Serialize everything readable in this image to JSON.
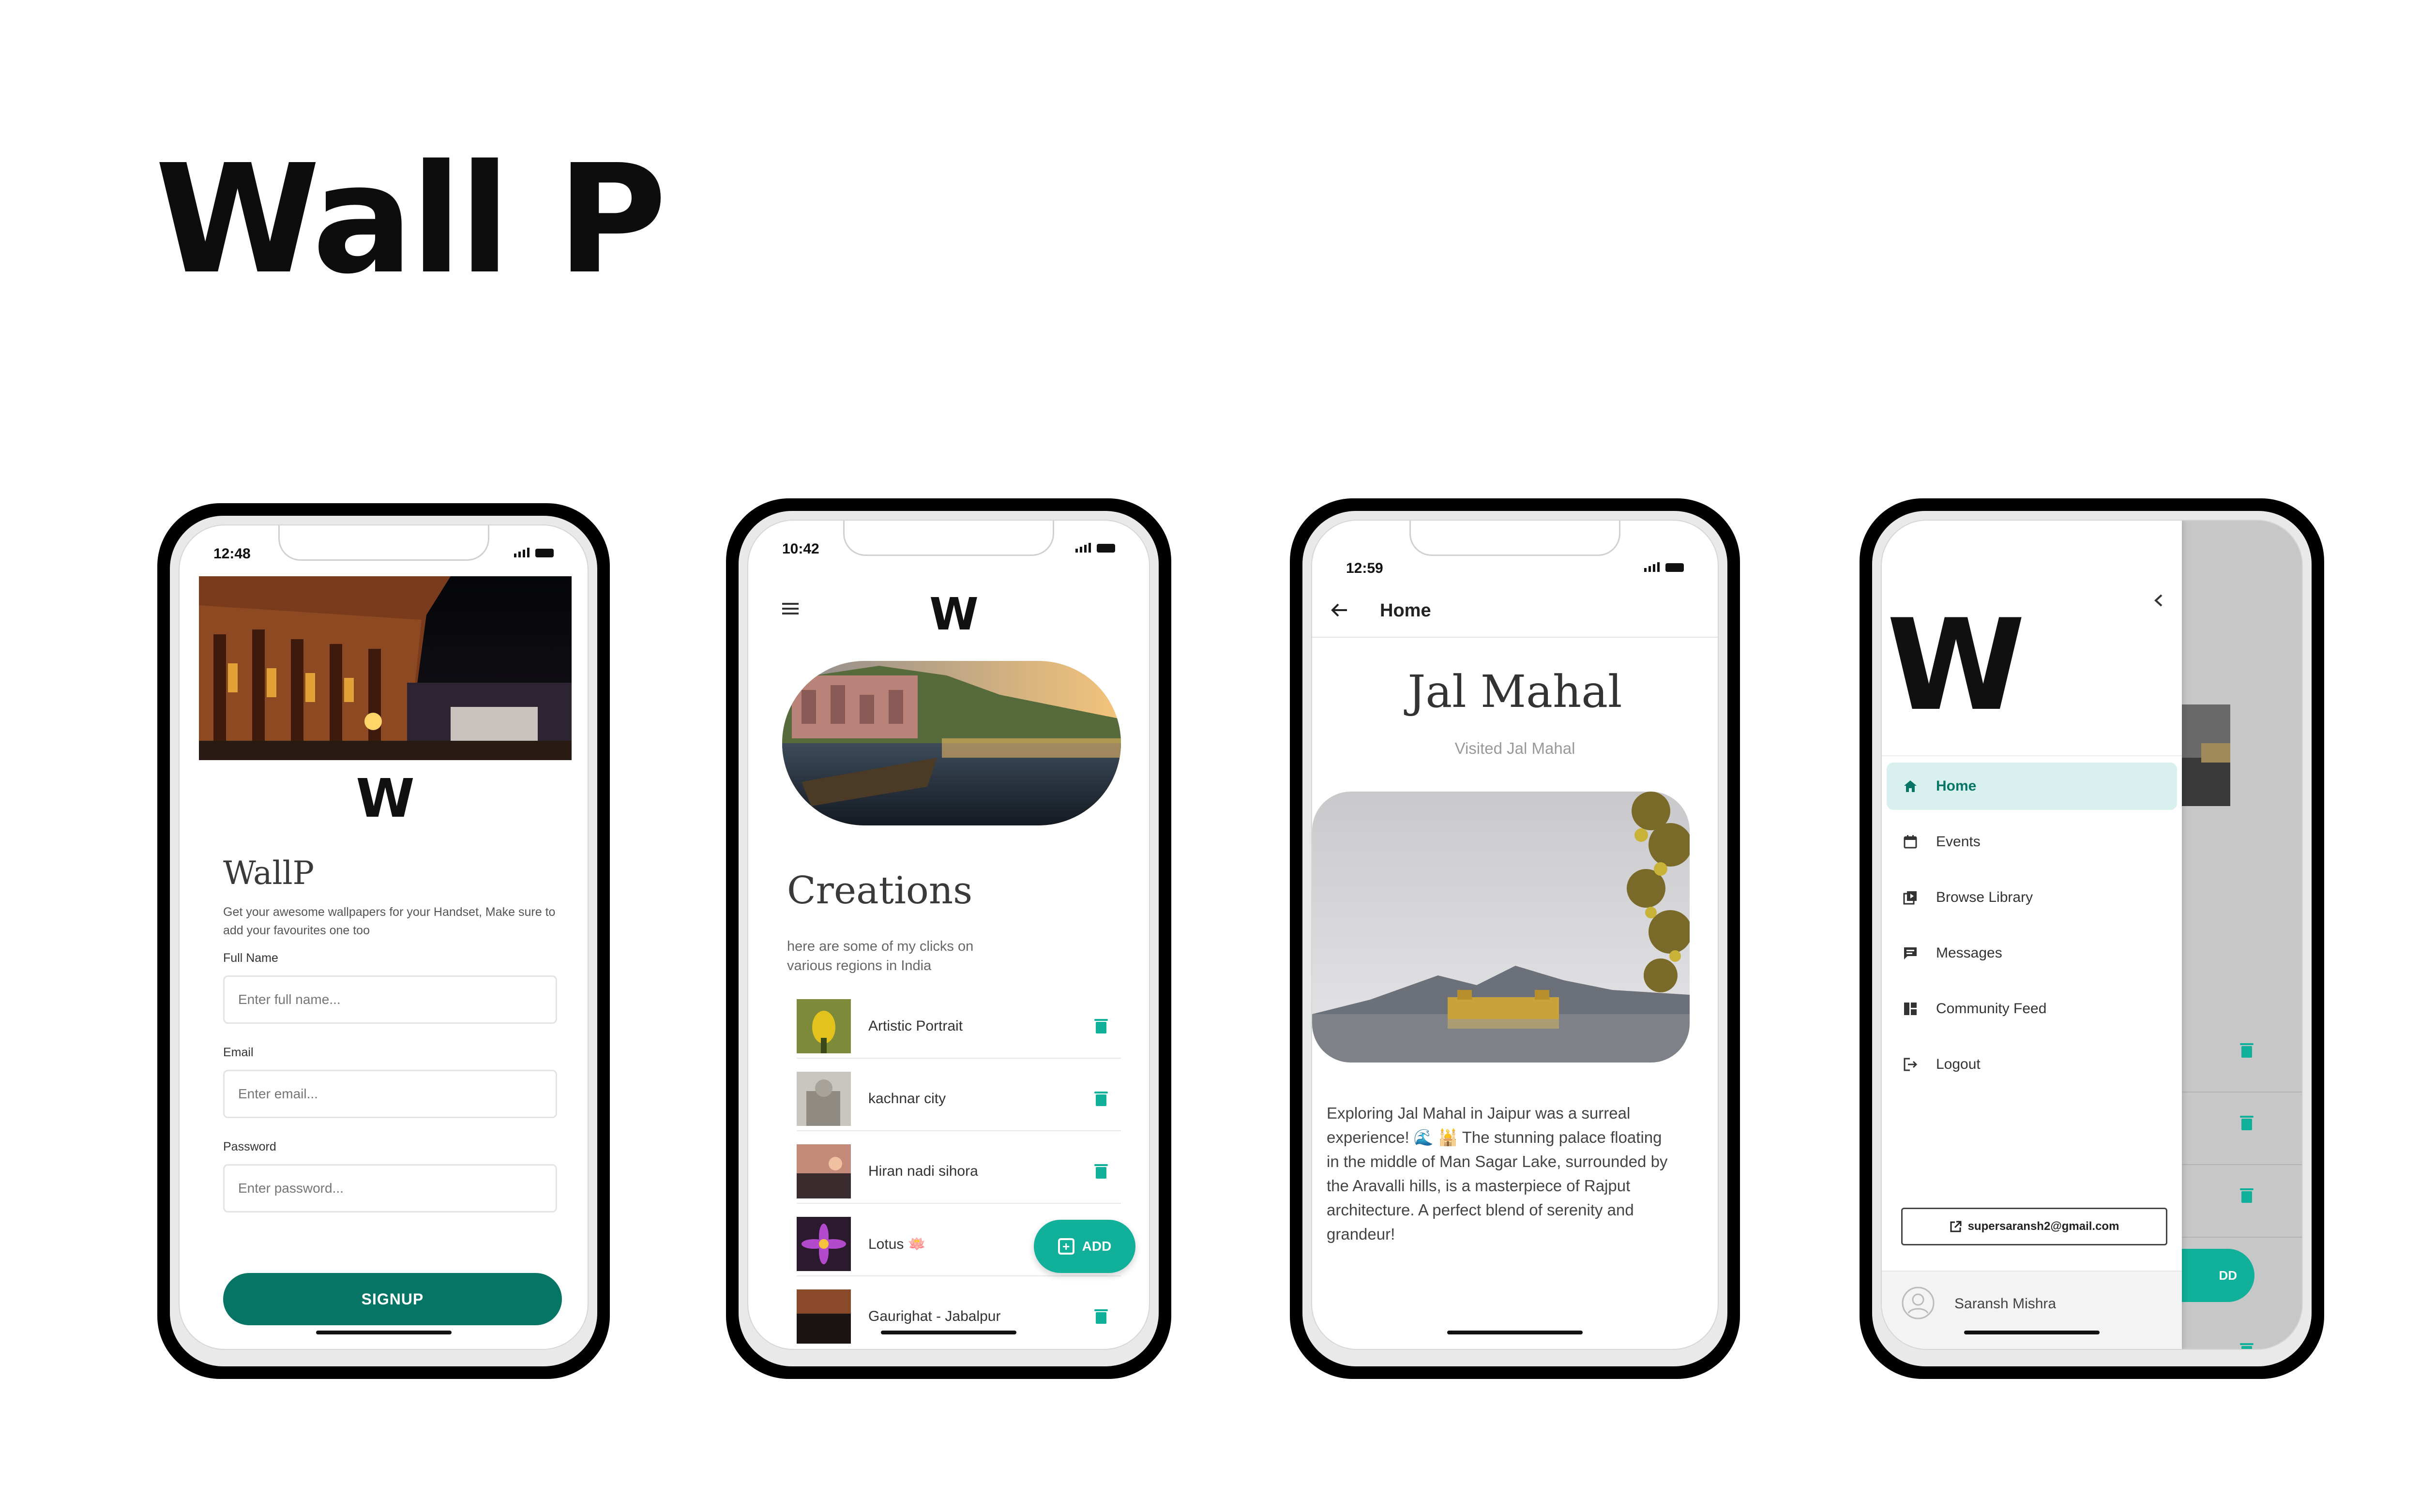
{
  "page": {
    "title": "Wall P"
  },
  "colors": {
    "primary": "#077565",
    "accent": "#10b09a",
    "menu_active_bg": "#d9f1ee",
    "phone_frame": "#000000"
  },
  "phone1": {
    "time": "12:48",
    "logo": "W",
    "app_name": "WallP",
    "description": "Get your awesome wallpapers for your Handset, Make sure to add your favourites one too",
    "fields": [
      {
        "label": "Full Name",
        "placeholder": "Enter full name..."
      },
      {
        "label": "Email",
        "placeholder": "Enter email..."
      },
      {
        "label": "Password",
        "placeholder": "Enter password..."
      }
    ],
    "signup_label": "SIGNUP"
  },
  "phone2": {
    "time": "10:42",
    "logo": "W",
    "heading": "Creations",
    "subtitle": "here are some of my clicks on various regions in India",
    "items": [
      {
        "label": "Artistic Portrait"
      },
      {
        "label": "kachnar city"
      },
      {
        "label": "Hiran nadi sihora"
      },
      {
        "label": "Lotus 🪷"
      },
      {
        "label": "Gaurighat - Jabalpur"
      }
    ],
    "add_label": "ADD"
  },
  "phone3": {
    "time": "12:59",
    "header": "Home",
    "title": "Jal Mahal",
    "subtitle": "Visited Jal Mahal",
    "body": "Exploring Jal Mahal in Jaipur was a surreal experience! 🌊 🕌 The stunning palace floating in the middle of Man Sagar Lake, surrounded by the Aravalli hills, is a masterpiece of Rajput architecture. A perfect blend of serenity and grandeur!"
  },
  "phone4": {
    "logo": "W",
    "menu": [
      {
        "label": "Home",
        "icon": "home-icon",
        "active": true
      },
      {
        "label": "Events",
        "icon": "calendar-icon",
        "active": false
      },
      {
        "label": "Browse Library",
        "icon": "library-icon",
        "active": false
      },
      {
        "label": "Messages",
        "icon": "message-icon",
        "active": false
      },
      {
        "label": "Community Feed",
        "icon": "dashboard-icon",
        "active": false
      },
      {
        "label": "Logout",
        "icon": "logout-icon",
        "active": false
      }
    ],
    "email": "supersaransh2@gmail.com",
    "user_name": "Saransh Mishra",
    "behind_add": "DD"
  }
}
